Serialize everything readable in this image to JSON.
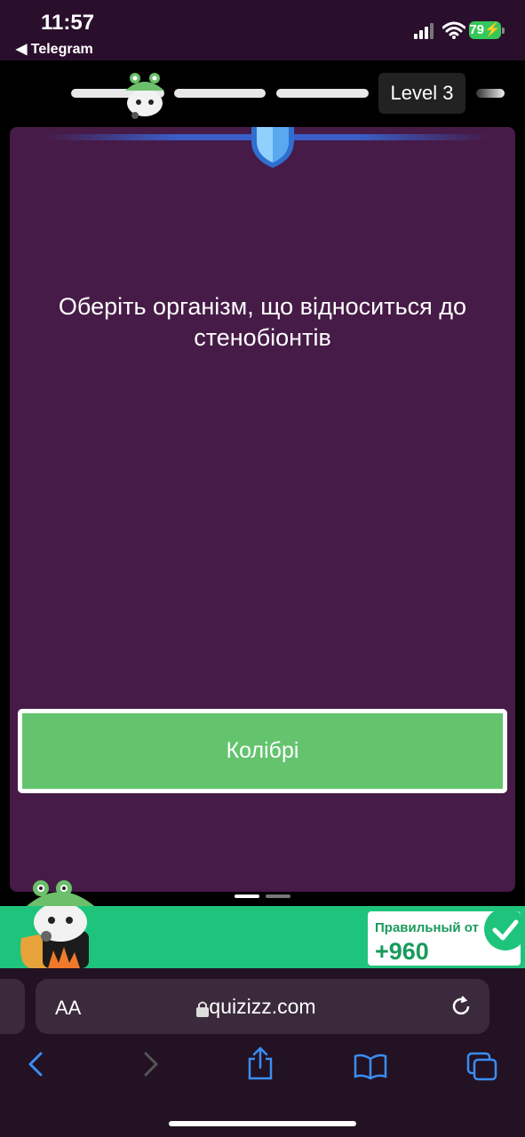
{
  "status": {
    "time": "11:57",
    "back_app": "Telegram",
    "battery": "79"
  },
  "progress": {
    "level_label": "Level 3"
  },
  "question": {
    "text": "Оберіть організм, що відноситься до стенобіонтів"
  },
  "answers": [
    {
      "label": "Колібрі"
    }
  ],
  "toast": {
    "label": "Правильный от",
    "score": "+960"
  },
  "browser": {
    "text_size_label": "AA",
    "url": "quizizz.com"
  },
  "colors": {
    "card_bg": "#461b47",
    "answer_bg": "#64c46e",
    "banner_bg": "#1ec47c",
    "accent_blue": "#3a5fc8"
  },
  "icons": [
    "frog-mascot-icon",
    "shield-icon",
    "lock-icon",
    "reload-icon",
    "back-icon",
    "forward-icon",
    "share-icon",
    "bookmarks-icon",
    "tabs-icon",
    "checkmark-icon"
  ]
}
